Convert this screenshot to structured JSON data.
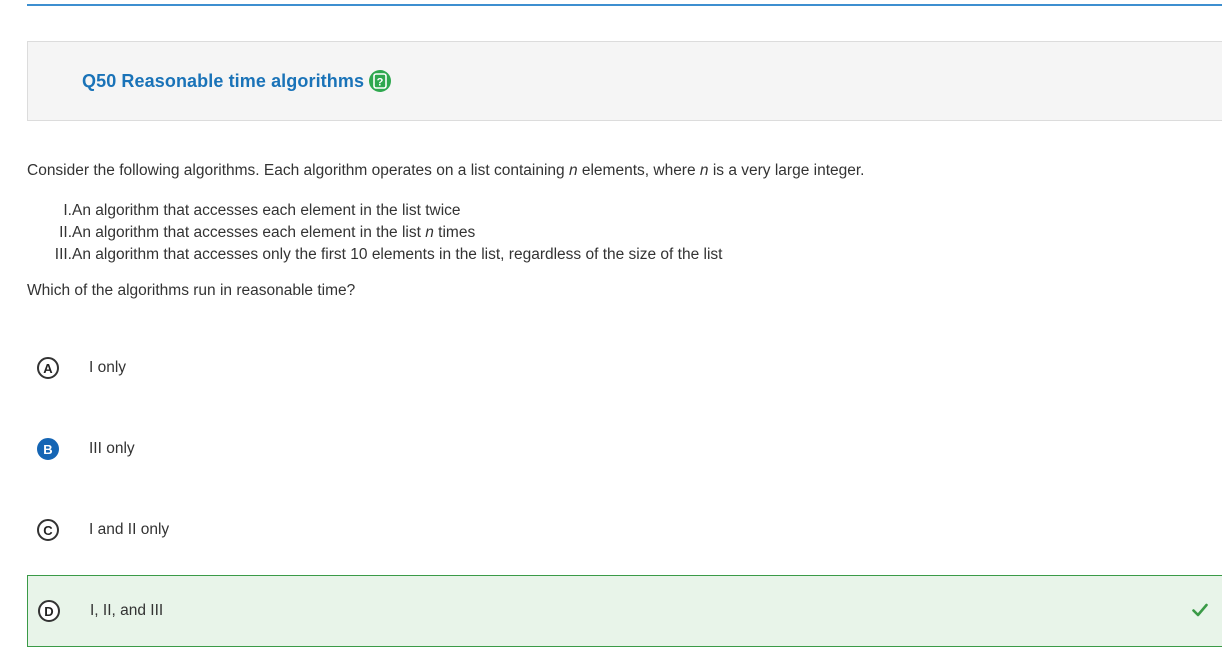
{
  "question": {
    "title": "Q50 Reasonable time algorithms",
    "help_icon": "help-icon",
    "prompt_before": "Consider the following algorithms. Each algorithm operates on a list containing ",
    "var_n": "n",
    "prompt_middle": " elements, where ",
    "prompt_after": " is a very large integer.",
    "statements": [
      {
        "num": "I.",
        "text_before": " An algorithm that accesses each element in the list twice",
        "var": "",
        "text_after": ""
      },
      {
        "num": "II.",
        "text_before": " An algorithm that accesses each element in the list ",
        "var": "n",
        "text_after": " times"
      },
      {
        "num": "III.",
        "text_before": " An algorithm that accesses only the first 10 elements in the list, regardless of the size of the list",
        "var": "",
        "text_after": ""
      }
    ],
    "ask": "Which of the algorithms run in reasonable time?"
  },
  "choices": [
    {
      "letter": "A",
      "text": "I only",
      "selected": false,
      "correct": false
    },
    {
      "letter": "B",
      "text": "III only",
      "selected": true,
      "correct": false
    },
    {
      "letter": "C",
      "text": "I and II only",
      "selected": false,
      "correct": false
    },
    {
      "letter": "D",
      "text": "I, II, and III",
      "selected": false,
      "correct": true
    }
  ],
  "colors": {
    "title": "#1a73b8",
    "help": "#2fa84f",
    "selected": "#1565b4",
    "correct_bg": "#e8f4e9",
    "correct_border": "#3a9a47",
    "check": "#3a9a47"
  },
  "icons": {
    "correct_marker": "checkmark-icon"
  }
}
